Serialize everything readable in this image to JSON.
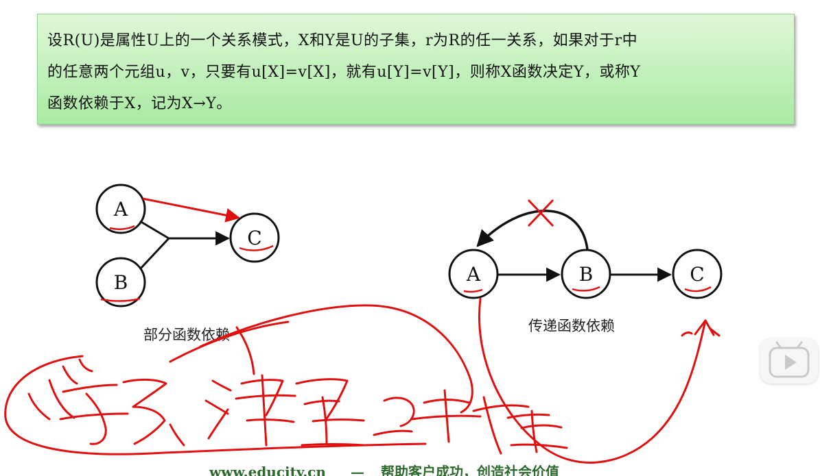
{
  "definition": {
    "line1": "设R(U)是属性U上的一个关系模式，X和Y是U的子集，r为R的任一关系，如果对于r中",
    "line2": "的任意两个元组u，v，只要有u[X]=v[X]，就有u[Y]=v[Y]，则称X函数决定Y，或称Y",
    "line3": "函数依赖于X，记为X→Y。"
  },
  "partial_diagram": {
    "node_a": "A",
    "node_b": "B",
    "node_c": "C",
    "caption": "部分函数依赖"
  },
  "transitive_diagram": {
    "node_a": "A",
    "node_b": "B",
    "node_c": "C",
    "caption": "传递函数依赖"
  },
  "footer": {
    "site": "www.educity.cn",
    "separator": "—",
    "slogan": "帮助客户成功，创造社会价值"
  },
  "icons": {
    "play": "play-icon"
  },
  "colors": {
    "box_top": "#dff7d8",
    "box_bottom": "#a9eaa2",
    "annotation": "#e01010",
    "footer": "#2d6b2d"
  }
}
